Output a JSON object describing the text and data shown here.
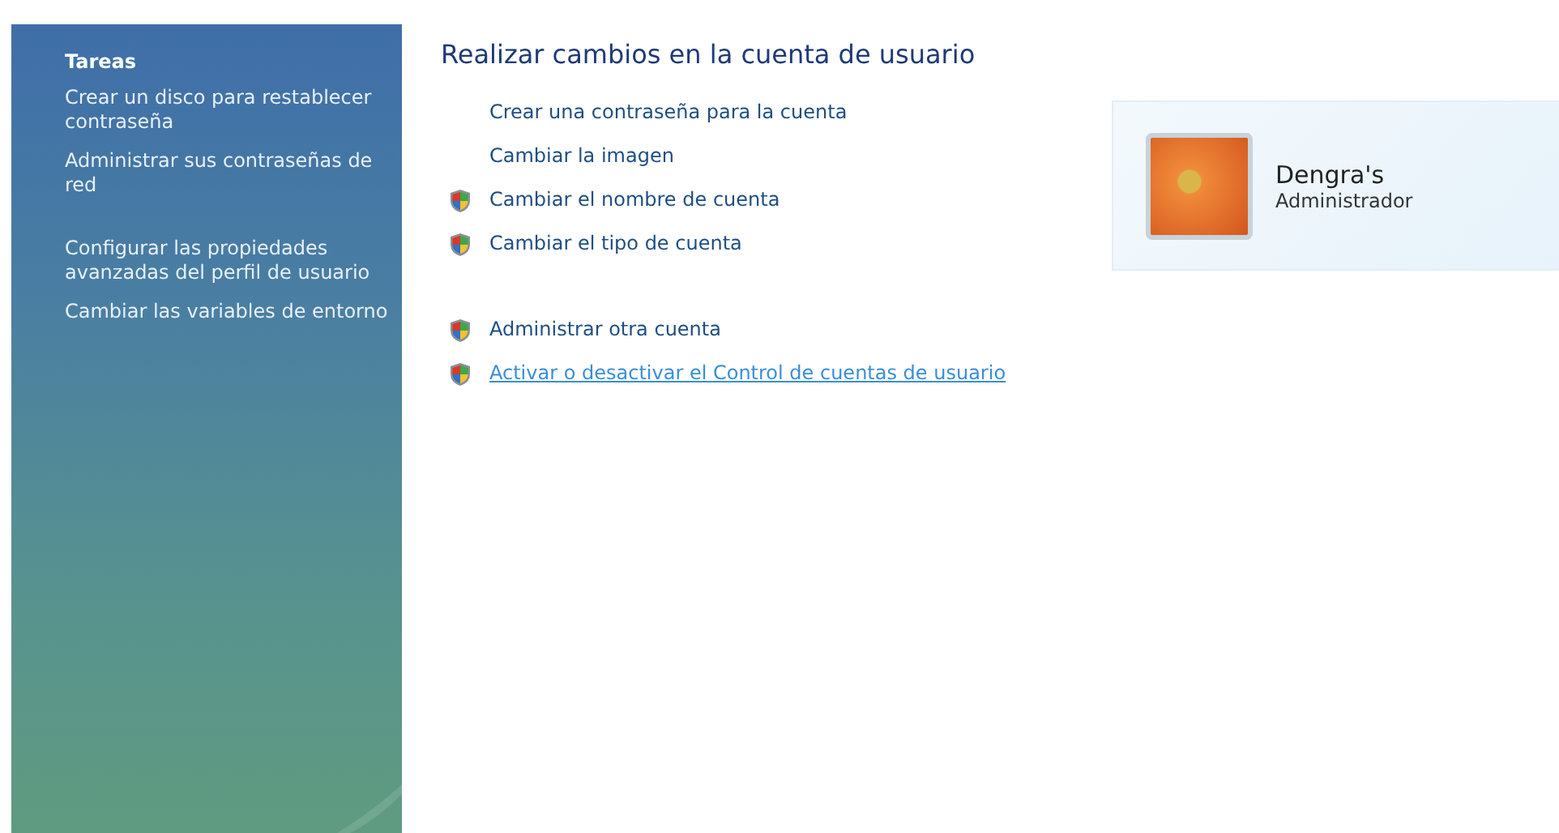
{
  "sidebar": {
    "title": "Tareas",
    "groups": [
      {
        "items": [
          "Crear un disco para restablecer contraseña",
          "Administrar sus contraseñas de red"
        ]
      },
      {
        "items": [
          "Configurar las propiedades avanzadas del perfil de usuario",
          "Cambiar las variables de entorno"
        ]
      }
    ]
  },
  "main": {
    "title": "Realizar cambios en la cuenta de usuario",
    "groups": [
      {
        "links": [
          {
            "label": "Crear una contraseña para la cuenta",
            "shield": false,
            "hovered": false
          },
          {
            "label": "Cambiar la imagen",
            "shield": false,
            "hovered": false
          },
          {
            "label": "Cambiar el nombre de cuenta",
            "shield": true,
            "hovered": false
          },
          {
            "label": "Cambiar el tipo de cuenta",
            "shield": true,
            "hovered": false
          }
        ]
      },
      {
        "links": [
          {
            "label": "Administrar otra cuenta",
            "shield": true,
            "hovered": false
          },
          {
            "label": "Activar o desactivar el Control de cuentas de usuario",
            "shield": true,
            "hovered": true
          }
        ]
      }
    ]
  },
  "account": {
    "name": "Dengra's",
    "role": "Administrador"
  }
}
